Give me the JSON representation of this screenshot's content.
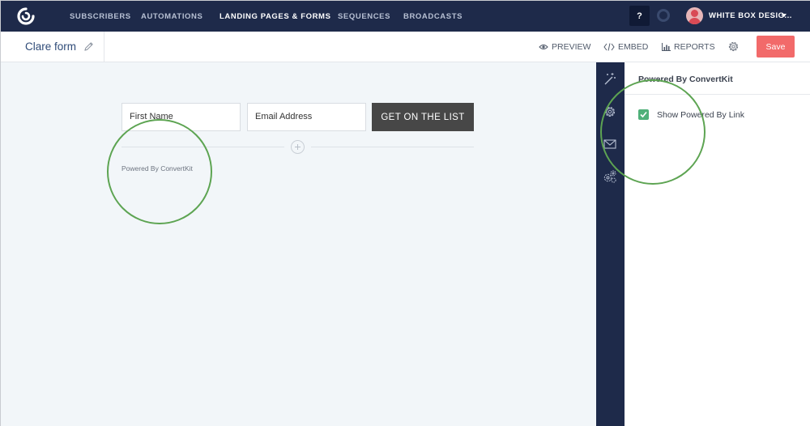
{
  "nav": {
    "items": [
      {
        "label": "SUBSCRIBERS"
      },
      {
        "label": "AUTOMATIONS"
      },
      {
        "label": "LANDING PAGES & FORMS"
      },
      {
        "label": "SEQUENCES"
      },
      {
        "label": "BROADCASTS"
      }
    ],
    "active_index": 2,
    "help_label": "?",
    "account_name": "WHITE BOX DESIG..."
  },
  "subheader": {
    "form_title": "Clare form",
    "preview_label": "PREVIEW",
    "embed_label": "EMBED",
    "reports_label": "REPORTS",
    "save_label": "Save"
  },
  "form": {
    "first_name_placeholder": "First Name",
    "email_placeholder": "Email Address",
    "submit_label": "GET ON THE LIST",
    "powered_by": "Powered By ConvertKit"
  },
  "panel": {
    "title": "Powered By ConvertKit",
    "checkbox_label": "Show Powered By Link",
    "checkbox_checked": true
  },
  "rail": {
    "icons": [
      "magic-wand-icon",
      "gear-icon",
      "mail-icon",
      "multi-gear-icon"
    ]
  },
  "colors": {
    "nav_bg": "#1e2a4a",
    "save_button": "#f26a6a",
    "checkbox": "#4fb079",
    "annotation": "#5da452",
    "submit_button": "#474747"
  }
}
